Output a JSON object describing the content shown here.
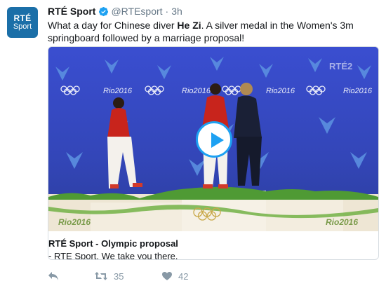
{
  "tweet": {
    "avatar": {
      "line1": "RTÉ",
      "line2": "Sport"
    },
    "author_name": "RTÉ Sport",
    "handle": "@RTEsport",
    "separator": "·",
    "time": "3h",
    "text_before": "What a day for Chinese diver ",
    "text_bold": "He Zi",
    "text_after": ". A silver medal in the Women's 3m springboard followed by a marriage proposal!"
  },
  "card": {
    "title": "RTÉ Sport - Olympic proposal",
    "description": "- RTE Sport. We take you there."
  },
  "media": {
    "watermark": "RTÉ2",
    "banner_text": "Rio2016",
    "podium_text": "Rio2016"
  },
  "actions": {
    "retweet_count": "35",
    "like_count": "42"
  },
  "colors": {
    "brand_blue": "#1da1f2",
    "avatar_bg": "#1b6fa8",
    "backdrop": "#3b4fc4"
  }
}
